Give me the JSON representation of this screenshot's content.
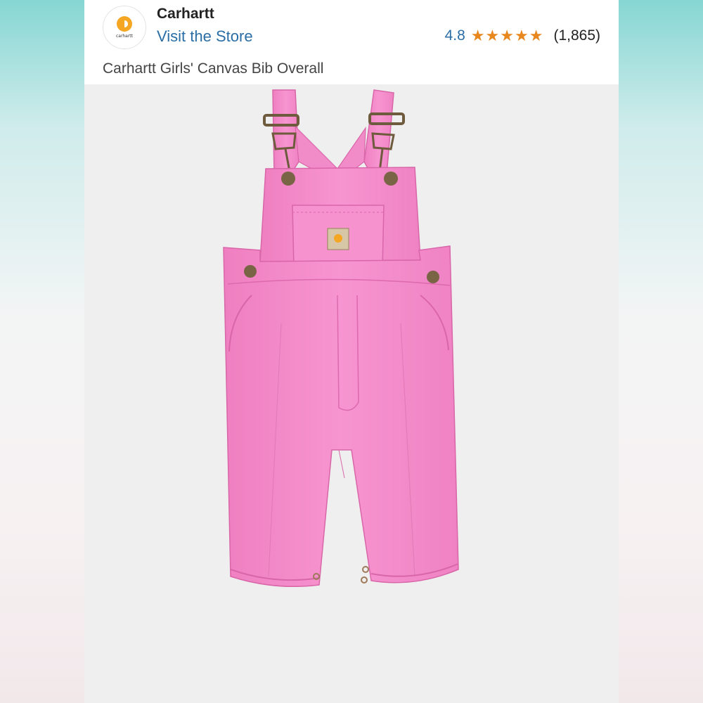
{
  "seller": {
    "brand_name": "Carhartt",
    "logo_text": "carhartt",
    "store_link": "Visit the Store"
  },
  "rating": {
    "value": "4.8",
    "stars": 5,
    "count": "(1,865)"
  },
  "product": {
    "title": "Carhartt Girls' Canvas Bib Overall"
  },
  "colors": {
    "link": "#2a6ea5",
    "star": "#e8871e",
    "overall_pink": "#f48fcb",
    "logo_orange": "#f5a623"
  }
}
